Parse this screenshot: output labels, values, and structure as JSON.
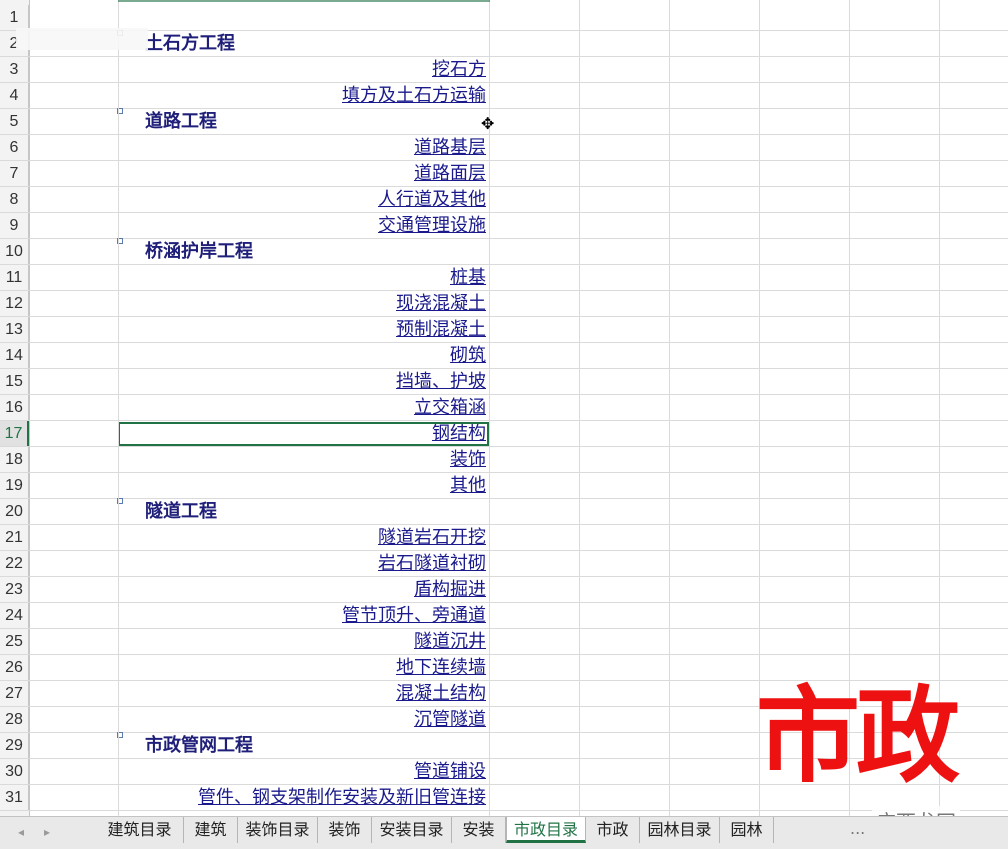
{
  "rows": [
    {
      "n": "1",
      "type": "empty"
    },
    {
      "n": "2",
      "type": "section",
      "text": "土石方工程"
    },
    {
      "n": "3",
      "type": "link",
      "text": "挖石方"
    },
    {
      "n": "4",
      "type": "link",
      "text": "填方及土石方运输"
    },
    {
      "n": "5",
      "type": "section",
      "text": "道路工程"
    },
    {
      "n": "6",
      "type": "link",
      "text": "道路基层"
    },
    {
      "n": "7",
      "type": "link",
      "text": "道路面层"
    },
    {
      "n": "8",
      "type": "link",
      "text": "人行道及其他"
    },
    {
      "n": "9",
      "type": "link",
      "text": "交通管理设施"
    },
    {
      "n": "10",
      "type": "section",
      "text": "桥涵护岸工程"
    },
    {
      "n": "11",
      "type": "link",
      "text": "桩基"
    },
    {
      "n": "12",
      "type": "link",
      "text": "现浇混凝土"
    },
    {
      "n": "13",
      "type": "link",
      "text": "预制混凝土"
    },
    {
      "n": "14",
      "type": "link",
      "text": "砌筑"
    },
    {
      "n": "15",
      "type": "link",
      "text": "挡墙、护坡"
    },
    {
      "n": "16",
      "type": "link",
      "text": "立交箱涵"
    },
    {
      "n": "17",
      "type": "link",
      "text": "钢结构",
      "active": true
    },
    {
      "n": "18",
      "type": "link",
      "text": "装饰"
    },
    {
      "n": "19",
      "type": "link",
      "text": "其他"
    },
    {
      "n": "20",
      "type": "section",
      "text": "隧道工程"
    },
    {
      "n": "21",
      "type": "link",
      "text": "隧道岩石开挖"
    },
    {
      "n": "22",
      "type": "link",
      "text": "岩石隧道衬砌"
    },
    {
      "n": "23",
      "type": "link",
      "text": "盾构掘进"
    },
    {
      "n": "24",
      "type": "link",
      "text": "管节顶升、旁通道"
    },
    {
      "n": "25",
      "type": "link",
      "text": "隧道沉井"
    },
    {
      "n": "26",
      "type": "link",
      "text": "地下连续墙"
    },
    {
      "n": "27",
      "type": "link",
      "text": "混凝土结构"
    },
    {
      "n": "28",
      "type": "link",
      "text": "沉管隧道"
    },
    {
      "n": "29",
      "type": "section",
      "text": "市政管网工程"
    },
    {
      "n": "30",
      "type": "link",
      "text": "管道铺设"
    },
    {
      "n": "31",
      "type": "link",
      "text": "管件、钢支架制作安装及新旧管连接"
    }
  ],
  "tabs": [
    {
      "label": "建筑目录"
    },
    {
      "label": "建筑"
    },
    {
      "label": "装饰目录"
    },
    {
      "label": "装饰"
    },
    {
      "label": "安装目录"
    },
    {
      "label": "安装"
    },
    {
      "label": "市政目录",
      "active": true
    },
    {
      "label": "市政"
    },
    {
      "label": "园林目录"
    },
    {
      "label": "园林"
    }
  ],
  "tabbar_more": "...",
  "overlay_caption": "市政",
  "watermark": "广西龙网",
  "colors": {
    "accent": "#217346",
    "section_text": "#1f1f7a",
    "link_text": "#1a1a8c",
    "caption": "#ee1111"
  }
}
